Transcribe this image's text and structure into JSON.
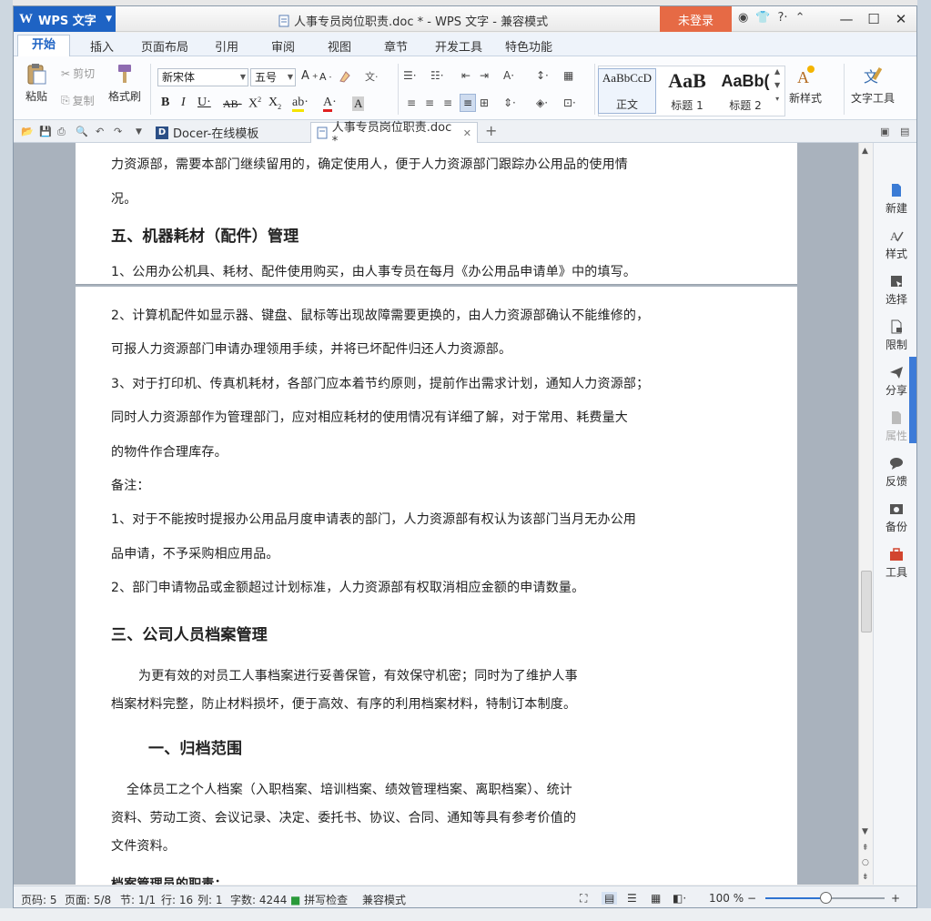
{
  "app": {
    "name": "WPS 文字",
    "doc_title": "人事专员岗位职责.doc * - WPS 文字 - 兼容模式",
    "login": "未登录"
  },
  "menu_tabs": [
    "开始",
    "插入",
    "页面布局",
    "引用",
    "审阅",
    "视图",
    "章节",
    "开发工具",
    "特色功能"
  ],
  "ribbon": {
    "paste": "粘贴",
    "cut": "剪切",
    "copy": "复制",
    "format_painter": "格式刷",
    "font_name": "新宋体",
    "font_size": "五号",
    "styles": [
      {
        "sample": "AaBbCcD",
        "label": "正文"
      },
      {
        "sample": "AaB",
        "label": "标题 1"
      },
      {
        "sample": "AaBb(",
        "label": "标题 2"
      }
    ],
    "new_style": "新样式",
    "text_tools": "文字工具"
  },
  "tabs": {
    "docer": "Docer-在线模板",
    "active_doc": "人事专员岗位职责.doc *",
    "add": "+"
  },
  "document": {
    "lines": [
      "力资源部，需要本部门继续留用的，确定使用人，便于人力资源部门跟踪办公用品的使用情",
      "况。",
      "五、机器耗材（配件）管理",
      "1、公用办公机具、耗材、配件使用购买，由人事专员在每月《办公用品申请单》中的填写。",
      "2、计算机配件如显示器、键盘、鼠标等出现故障需要更换的，由人力资源部确认不能维修的，",
      "可报人力资源部门申请办理领用手续，并将已坏配件归还人力资源部。",
      "3、对于打印机、传真机耗材，各部门应本着节约原则，提前作出需求计划，通知人力资源部；",
      "同时人力资源部作为管理部门，应对相应耗材的使用情况有详细了解，对于常用、耗费量大",
      "的物件作合理库存。",
      "备注：",
      "1、对于不能按时提报办公用品月度申请表的部门，人力资源部有权认为该部门当月无办公用",
      "品申请，不予采购相应用品。",
      "2、部门申请物品或金额超过计划标准，人力资源部有权取消相应金额的申请数量。",
      "三、公司人员档案管理",
      "为更有效的对员工人事档案进行妥善保管，有效保守机密；同时为了维护人事",
      "档案材料完整，防止材料损坏，便于高效、有序的利用档案材料，特制订本制度。",
      "一、归档范围",
      "全体员工之个人档案（入职档案、培训档案、绩效管理档案、离职档案）、统计",
      "资料、劳动工资、会议记录、决定、委托书、协议、合同、通知等具有参考价值的",
      "文件资料。",
      "档案管理员的职责："
    ]
  },
  "side_panel": [
    "新建",
    "样式",
    "选择",
    "限制",
    "分享",
    "属性",
    "反馈",
    "备份",
    "工具"
  ],
  "status": {
    "page_num": "页码: 5",
    "pages": "页面: 5/8",
    "section": "节: 1/1",
    "row": "行: 16",
    "col": "列: 1",
    "words": "字数: 4244",
    "spell": "拼写检查",
    "compat": "兼容模式",
    "zoom": "100 %"
  }
}
